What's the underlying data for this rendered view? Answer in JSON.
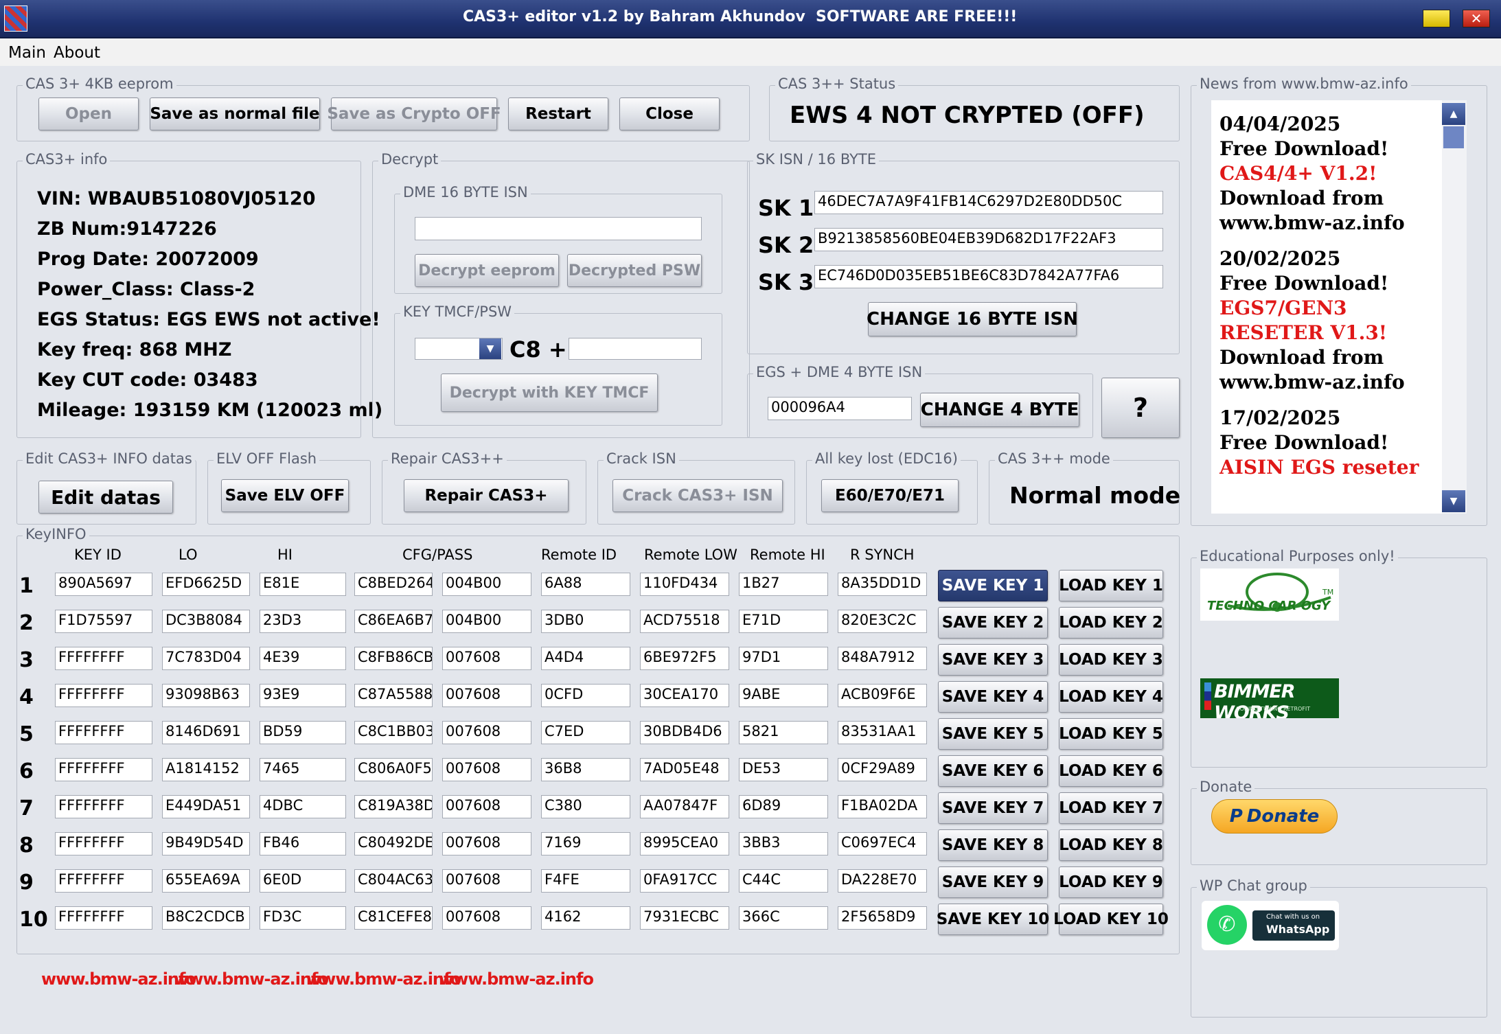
{
  "window": {
    "title": "CAS3+ editor v1.2 by Bahram Akhundov",
    "banner": "SOFTWARE ARE FREE!!!",
    "icon": "app-icon",
    "min_icon": "minimize-icon",
    "close_icon": "close-icon"
  },
  "menu": {
    "main": "Main",
    "about": "About"
  },
  "eeprom": {
    "legend": "CAS 3+ 4KB eeprom",
    "open": "Open",
    "save_normal": "Save as normal file",
    "save_crypto": "Save as Crypto OFF",
    "restart": "Restart",
    "close": "Close"
  },
  "status": {
    "legend": "CAS 3++ Status",
    "value": "EWS 4 NOT CRYPTED (OFF)"
  },
  "info": {
    "legend": "CAS3+ info",
    "lines": [
      "VIN: WBAUB51080VJ05120",
      "ZB Num:9147226",
      "Prog Date:  20072009",
      "Power_Class:  Class-2",
      "EGS Status:  EGS EWS not active!",
      "Key freq:  868 MHZ",
      "Key CUT code: 03483",
      "Mileage:  193159 KM (120023 ml)"
    ]
  },
  "decrypt": {
    "legend": "Decrypt",
    "dme_legend": "DME 16 BYTE ISN",
    "dme_value": "",
    "btn_eeprom": "Decrypt eeprom",
    "btn_psw": "Decrypted PSW",
    "tmcf_legend": "KEY TMCF/PSW",
    "c8_label": "C8 +",
    "tmcf_sel": "",
    "tmcf_value": "",
    "btn_tmcf": "Decrypt with KEY TMCF"
  },
  "sk": {
    "legend": "SK ISN / 16 BYTE",
    "sk1_label": "SK 1",
    "sk1": "46DEC7A7A9F41FB14C6297D2E80DD50C",
    "sk2_label": "SK 2",
    "sk2": "B9213858560BE04EB39D682D17F22AF3",
    "sk3_label": "SK 3",
    "sk3": "EC746D0D035EB51BE6C83D7842A77FA6",
    "btn": "CHANGE 16 BYTE ISN"
  },
  "egs": {
    "legend": "EGS + DME 4 BYTE ISN",
    "value": "000096A4",
    "btn": "CHANGE 4 BYTE",
    "help": "?"
  },
  "actions": {
    "edit_legend": "Edit CAS3+ INFO datas",
    "edit_btn": "Edit datas",
    "elv_legend": "ELV OFF Flash",
    "elv_btn": "Save ELV OFF",
    "repair_legend": "Repair CAS3++",
    "repair_btn": "Repair CAS3+",
    "crack_legend": "Crack ISN",
    "crack_btn": "Crack CAS3+ ISN",
    "akl_legend": "All key lost (EDC16)",
    "akl_btn": "E60/E70/E71",
    "mode_legend": "CAS 3++ mode",
    "mode_value": "Normal mode"
  },
  "keyinfo": {
    "legend": "KeyINFO",
    "headers": [
      "KEY ID",
      "LO",
      "HI",
      "CFG/PASS",
      "Remote ID",
      "Remote LOW",
      "Remote HI",
      "R SYNCH"
    ],
    "rows": [
      {
        "n": "1",
        "id": "890A5697",
        "lo": "EFD6625D",
        "hi": "E81E",
        "cfg": "C8BED264",
        "pass": "004B00",
        "rid": "6A88",
        "rlow": "110FD434",
        "rhi": "1B27",
        "rsync": "8A35DD1D",
        "save": "SAVE KEY 1",
        "load": "LOAD KEY 1"
      },
      {
        "n": "2",
        "id": "F1D75597",
        "lo": "DC3B8084",
        "hi": "23D3",
        "cfg": "C86EA6B7",
        "pass": "004B00",
        "rid": "3DB0",
        "rlow": "ACD75518",
        "rhi": "E71D",
        "rsync": "820E3C2C",
        "save": "SAVE KEY 2",
        "load": "LOAD KEY 2"
      },
      {
        "n": "3",
        "id": "FFFFFFFF",
        "lo": "7C783D04",
        "hi": "4E39",
        "cfg": "C8FB86CB",
        "pass": "007608",
        "rid": "A4D4",
        "rlow": "6BE972F5",
        "rhi": "97D1",
        "rsync": "848A7912",
        "save": "SAVE KEY 3",
        "load": "LOAD KEY 3"
      },
      {
        "n": "4",
        "id": "FFFFFFFF",
        "lo": "93098B63",
        "hi": "93E9",
        "cfg": "C87A5588",
        "pass": "007608",
        "rid": "0CFD",
        "rlow": "30CEA170",
        "rhi": "9ABE",
        "rsync": "ACB09F6E",
        "save": "SAVE KEY 4",
        "load": "LOAD KEY 4"
      },
      {
        "n": "5",
        "id": "FFFFFFFF",
        "lo": "8146D691",
        "hi": "BD59",
        "cfg": "C8C1BB03",
        "pass": "007608",
        "rid": "C7ED",
        "rlow": "30BDB4D6",
        "rhi": "5821",
        "rsync": "83531AA1",
        "save": "SAVE KEY 5",
        "load": "LOAD KEY 5"
      },
      {
        "n": "6",
        "id": "FFFFFFFF",
        "lo": "A1814152",
        "hi": "7465",
        "cfg": "C806A0F5",
        "pass": "007608",
        "rid": "36B8",
        "rlow": "7AD05E48",
        "rhi": "DE53",
        "rsync": "0CF29A89",
        "save": "SAVE KEY 6",
        "load": "LOAD KEY 6"
      },
      {
        "n": "7",
        "id": "FFFFFFFF",
        "lo": "E449DA51",
        "hi": "4DBC",
        "cfg": "C819A38D",
        "pass": "007608",
        "rid": "C380",
        "rlow": "AA07847F",
        "rhi": "6D89",
        "rsync": "F1BA02DA",
        "save": "SAVE KEY 7",
        "load": "LOAD KEY 7"
      },
      {
        "n": "8",
        "id": "FFFFFFFF",
        "lo": "9B49D54D",
        "hi": "FB46",
        "cfg": "C80492DE",
        "pass": "007608",
        "rid": "7169",
        "rlow": "8995CEA0",
        "rhi": "3BB3",
        "rsync": "C0697EC4",
        "save": "SAVE KEY 8",
        "load": "LOAD KEY 8"
      },
      {
        "n": "9",
        "id": "FFFFFFFF",
        "lo": "655EA69A",
        "hi": "6E0D",
        "cfg": "C804AC63",
        "pass": "007608",
        "rid": "F4FE",
        "rlow": "0FA917CC",
        "rhi": "C44C",
        "rsync": "DA228E70",
        "save": "SAVE KEY 9",
        "load": "LOAD KEY 9"
      },
      {
        "n": "10",
        "id": "FFFFFFFF",
        "lo": "B8C2CDCB",
        "hi": "FD3C",
        "cfg": "C81CEFE8",
        "pass": "007608",
        "rid": "4162",
        "rlow": "7931ECBC",
        "rhi": "366C",
        "rsync": "2F5658D9",
        "save": "SAVE KEY 10",
        "load": "LOAD KEY 10"
      }
    ]
  },
  "news": {
    "legend": "News from www.bmw-az.info",
    "items": [
      {
        "text": "04/04/2025",
        "red": false
      },
      {
        "text": "Free Download!",
        "red": false
      },
      {
        "text": "CAS4/4+ V1.2!",
        "red": true
      },
      {
        "text": "Download from",
        "red": false
      },
      {
        "text": "www.bmw-az.info",
        "red": false
      },
      {
        "text": "20/02/2025",
        "red": false
      },
      {
        "text": "Free Download!",
        "red": false
      },
      {
        "text": "EGS7/GEN3",
        "red": true
      },
      {
        "text": "RESETER V1.3!",
        "red": true
      },
      {
        "text": "Download from",
        "red": false
      },
      {
        "text": "www.bmw-az.info",
        "red": false
      },
      {
        "text": "17/02/2025",
        "red": false
      },
      {
        "text": "Free Download!",
        "red": false
      },
      {
        "text": "AISIN EGS reseter",
        "red": true
      }
    ]
  },
  "edu": {
    "legend": "Educational Purposes only!",
    "logo1": "TECHNO CAR OGY",
    "logo1_tm": "TM",
    "logo2": "BIMMER WORKS",
    "logo2_sub": "CODING TUNING RETROFIT"
  },
  "donate": {
    "legend": "Donate",
    "btn": "Donate"
  },
  "wp": {
    "legend": "WP Chat group",
    "line1": "Chat with us on",
    "line2": "WhatsApp"
  },
  "footer": {
    "links": [
      "www.bmw-az.info",
      "www.bmw-az.info",
      "www.bmw-az.info",
      "www.bmw-az.info"
    ]
  },
  "colors": {
    "accent_red": "#e01818",
    "title_blue": "#1f3270"
  }
}
